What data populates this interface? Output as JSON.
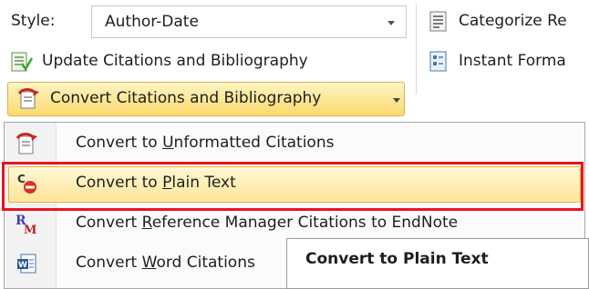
{
  "ribbon": {
    "style_label": "Style:",
    "style_value": "Author-Date",
    "categorize_label": "Categorize Re",
    "update_label": "Update Citations and Bibliography",
    "instant_label": "Instant Forma",
    "convert_label": "Convert Citations and Bibliography",
    "icons": [
      "categorize-icon",
      "update-citations-icon",
      "instant-format-icon",
      "convert-citations-icon",
      "dropdown-arrow-icon"
    ]
  },
  "menu": {
    "items": [
      {
        "label_pre": "Convert to ",
        "label_acc": "U",
        "label_post": "nformatted Citations",
        "icon": "convert-unformatted-icon",
        "highlighted": false
      },
      {
        "label_pre": "Convert to ",
        "label_acc": "P",
        "label_post": "lain Text",
        "icon": "convert-plain-text-icon",
        "highlighted": true
      },
      {
        "label_pre": "Convert ",
        "label_acc": "R",
        "label_post": "eference Manager Citations to EndNote",
        "icon": "reference-manager-icon",
        "highlighted": false
      },
      {
        "label_pre": "Convert ",
        "label_acc": "W",
        "label_post": "ord Citations",
        "icon": "word-document-icon",
        "highlighted": false
      }
    ]
  },
  "tooltip": {
    "title": "Convert to Plain Text"
  },
  "colors": {
    "highlight_border": "#e8141f",
    "button_fill": "#fbd96c"
  }
}
